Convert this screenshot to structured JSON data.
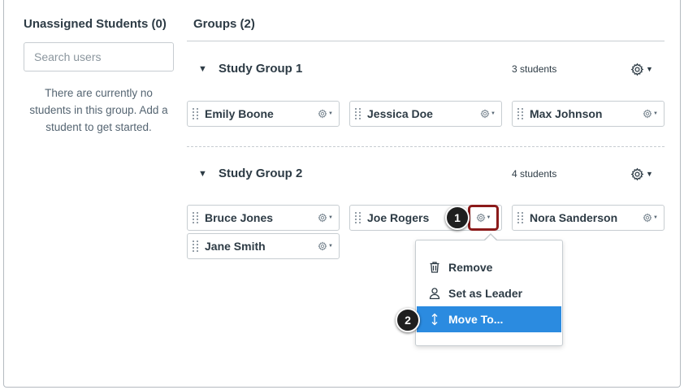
{
  "unassigned": {
    "title": "Unassigned Students (0)",
    "search_placeholder": "Search users",
    "empty_message": "There are currently no students in this group. Add a student to get started."
  },
  "groups": {
    "title": "Groups (2)",
    "list": [
      {
        "name": "Study Group 1",
        "count": "3 students",
        "members": [
          "Emily Boone",
          "Jessica Doe",
          "Max Johnson"
        ]
      },
      {
        "name": "Study Group 2",
        "count": "4 students",
        "members": [
          "Bruce Jones",
          "Joe Rogers",
          "Nora Sanderson",
          "Jane Smith"
        ]
      }
    ]
  },
  "context_menu": {
    "items": [
      {
        "label": "Remove",
        "icon": "trash-icon"
      },
      {
        "label": "Set as Leader",
        "icon": "user-icon"
      },
      {
        "label": "Move To...",
        "icon": "move-vertical-icon",
        "active": true
      }
    ]
  },
  "callouts": [
    "1",
    "2"
  ],
  "colors": {
    "accent": "#2b8be0",
    "highlight": "#8b1a1a",
    "text": "#2d3b45"
  }
}
